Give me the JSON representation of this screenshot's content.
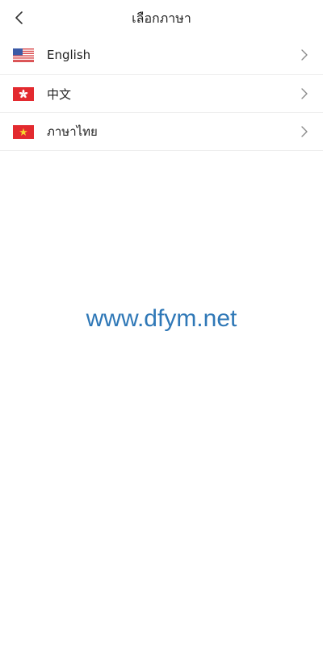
{
  "header": {
    "title": "เลือกภาษา",
    "back_icon": "chevron-left-icon"
  },
  "languages": [
    {
      "label": "English",
      "flag": "us-flag-icon"
    },
    {
      "label": "中文",
      "flag": "hk-flag-icon"
    },
    {
      "label": "ภาษาไทย",
      "flag": "vn-flag-icon"
    }
  ],
  "watermark": "www.dfym.net",
  "colors": {
    "watermark": "#2f78b7",
    "divider": "#ececec",
    "chevron": "#8a8a8a"
  }
}
